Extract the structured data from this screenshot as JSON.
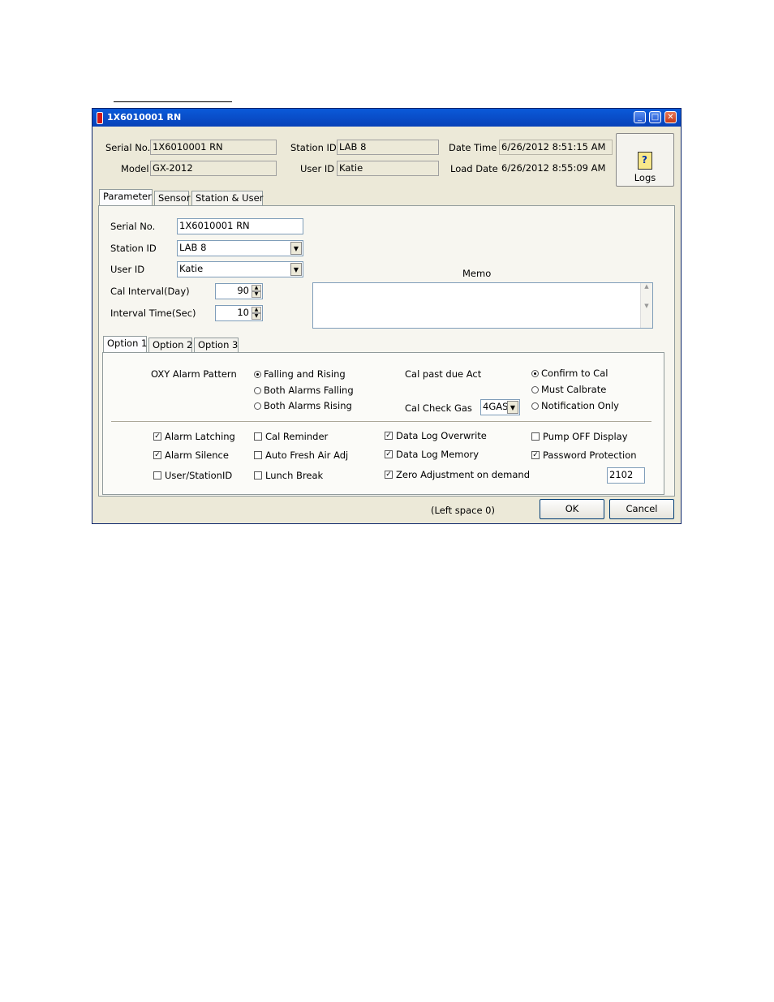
{
  "window": {
    "title": "1X6010001 RN"
  },
  "header": {
    "serial_label": "Serial No.",
    "serial_value": "1X6010001 RN",
    "model_label": "Model",
    "model_value": "GX-2012",
    "station_label": "Station ID",
    "station_value": "LAB 8",
    "user_label": "User ID",
    "user_value": "Katie",
    "datetime_label": "Date Time",
    "datetime_value": "6/26/2012 8:51:15 AM",
    "loaddate_label": "Load Date",
    "loaddate_value": "6/26/2012 8:55:09 AM",
    "logs_label": "Logs"
  },
  "tabs": [
    "Parameter",
    "Sensor",
    "Station & User"
  ],
  "parameter": {
    "serial_label": "Serial No.",
    "serial_value": "1X6010001 RN",
    "station_label": "Station ID",
    "station_value": "LAB 8",
    "user_label": "User ID",
    "user_value": "Katie",
    "cal_interval_label": "Cal Interval(Day)",
    "cal_interval_value": "90",
    "interval_time_label": "Interval Time(Sec)",
    "interval_time_value": "10",
    "memo_label": "Memo"
  },
  "option_tabs": [
    "Option 1",
    "Option 2",
    "Option 3"
  ],
  "option1": {
    "oxy_label": "OXY Alarm Pattern",
    "oxy_options": [
      "Falling and Rising",
      "Both Alarms Falling",
      "Both Alarms Rising"
    ],
    "oxy_selected": 0,
    "cal_past_label": "Cal past due Act",
    "cal_past_options": [
      "Confirm to Cal",
      "Must Calbrate",
      "Notification Only"
    ],
    "cal_past_selected": 0,
    "cal_check_label": "Cal Check Gas",
    "cal_check_value": "4GAS",
    "checkboxes": {
      "alarm_latching": {
        "label": "Alarm Latching",
        "checked": true
      },
      "alarm_silence": {
        "label": "Alarm Silence",
        "checked": true
      },
      "user_station": {
        "label": "User/StationID",
        "checked": false
      },
      "cal_reminder": {
        "label": "Cal Reminder",
        "checked": false
      },
      "auto_fresh": {
        "label": "Auto Fresh Air Adj",
        "checked": false
      },
      "lunch_break": {
        "label": "Lunch Break",
        "checked": false
      },
      "data_log_overwrite": {
        "label": "Data Log Overwrite",
        "checked": true
      },
      "data_log_memory": {
        "label": "Data Log Memory",
        "checked": true
      },
      "zero_adjust": {
        "label": "Zero Adjustment on demand",
        "checked": true
      },
      "pump_off": {
        "label": "Pump OFF Display",
        "checked": false
      },
      "password": {
        "label": "Password Protection",
        "checked": true
      }
    },
    "password_value": "2102"
  },
  "footer": {
    "left_space": "(Left space 0)",
    "ok_label": "OK",
    "cancel_label": "Cancel"
  }
}
